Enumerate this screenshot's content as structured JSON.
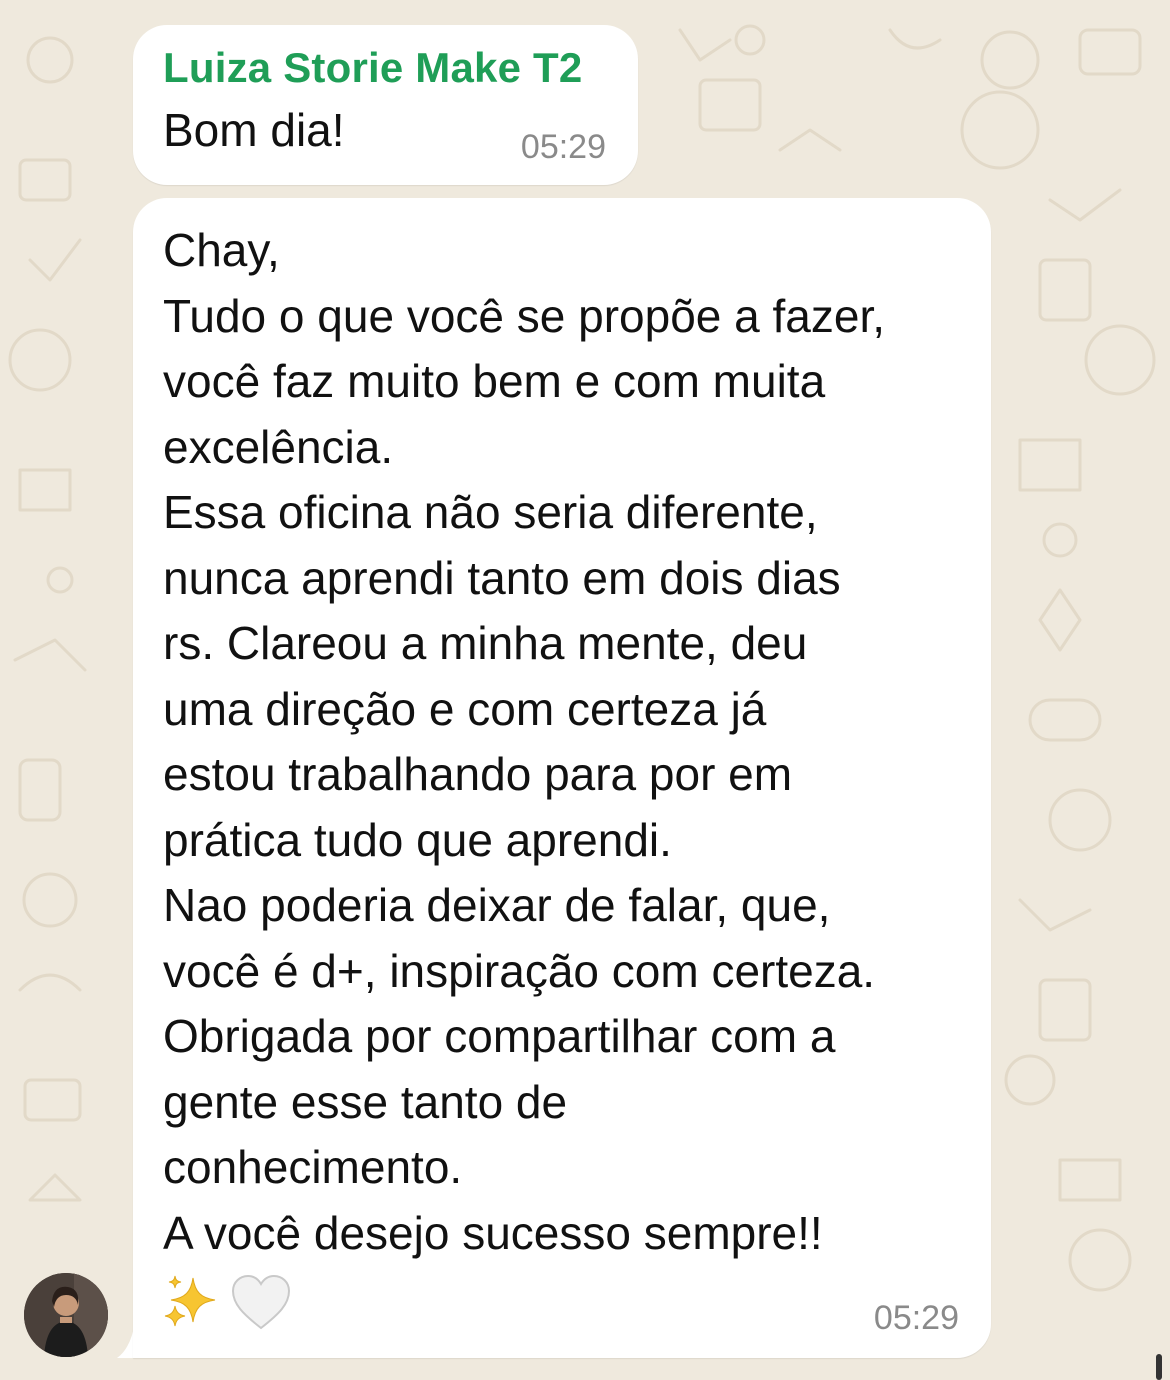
{
  "chat": {
    "message1": {
      "sender": "Luiza Storie Make T2",
      "text": "Bom dia!",
      "time": "05:29"
    },
    "message2": {
      "text": "Chay,\nTudo o que você se propõe a fazer,\nvocê faz muito bem e com muita\nexcelência.\nEssa oficina não seria diferente,\nnunca aprendi tanto em dois dias\nrs. Clareou a minha mente, deu\numa direção e com certeza já\nestou trabalhando para por em\nprática tudo que aprendi.\nNao poderia deixar de falar, que,\nvocê é d+, inspiração com certeza.\nObrigada por compartilhar com a\ngente esse tanto de\nconhecimento.\nA você desejo sucesso sempre!!",
      "emojis": [
        "sparkles-emoji",
        "white-heart-emoji"
      ],
      "time": "05:29"
    }
  },
  "colors": {
    "sender_name": "#1f9e57",
    "bubble": "#ffffff",
    "wallpaper": "#efe9dd",
    "timestamp": "#8a8a8a"
  }
}
